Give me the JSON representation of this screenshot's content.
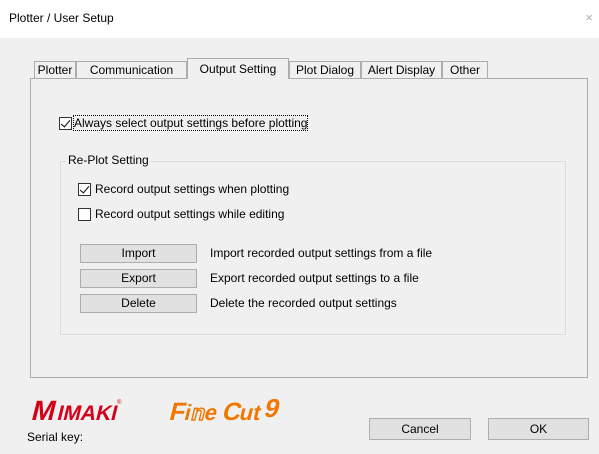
{
  "window": {
    "title": "Plotter / User Setup",
    "close_glyph": "×"
  },
  "tabs": [
    {
      "label": "Plotter"
    },
    {
      "label": "Communication"
    },
    {
      "label": "Output Setting"
    },
    {
      "label": "Plot Dialog"
    },
    {
      "label": "Alert Display"
    },
    {
      "label": "Other"
    }
  ],
  "active_tab": "Output Setting",
  "always_select": {
    "label": "Always select output settings before plotting",
    "checked": true
  },
  "replot": {
    "title": "Re-Plot Setting",
    "record_when_plotting": {
      "label": "Record output settings when plotting",
      "checked": true
    },
    "record_while_editing": {
      "label": "Record output settings while editing",
      "checked": false
    },
    "actions": [
      {
        "button": "Import",
        "description": "Import recorded output settings from a file"
      },
      {
        "button": "Export",
        "description": "Export recorded output settings to a file"
      },
      {
        "button": "Delete",
        "description": "Delete the recorded output settings"
      }
    ]
  },
  "footer": {
    "logo_brand": "MIMAKI",
    "logo_product": "FineCut9",
    "serial_label": "Serial key:",
    "cancel_label": "Cancel",
    "ok_label": "OK"
  },
  "colors": {
    "brand_red": "#d4001a",
    "product_orange": "#f07800",
    "background": "#f0f0f0"
  }
}
